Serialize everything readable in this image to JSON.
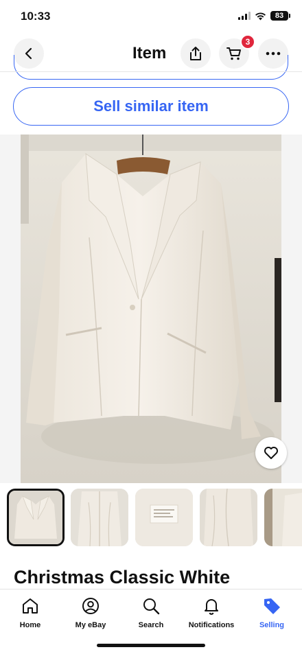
{
  "status_bar": {
    "time": "10:33",
    "battery": "83"
  },
  "header": {
    "title": "Item",
    "cart_count": "3"
  },
  "actions": {
    "sell_similar_label": "Sell similar item"
  },
  "gallery": {
    "image_count": 5,
    "selected_index": 0
  },
  "item": {
    "title": "Christmas Classic White"
  },
  "tab_bar": {
    "tabs": [
      {
        "label": "Home",
        "icon": "home-icon"
      },
      {
        "label": "My eBay",
        "icon": "profile-icon"
      },
      {
        "label": "Search",
        "icon": "search-icon"
      },
      {
        "label": "Notifications",
        "icon": "bell-icon"
      },
      {
        "label": "Selling",
        "icon": "tag-icon",
        "active": true
      }
    ]
  },
  "colors": {
    "accent": "#3665f3",
    "badge": "#e0263c"
  }
}
